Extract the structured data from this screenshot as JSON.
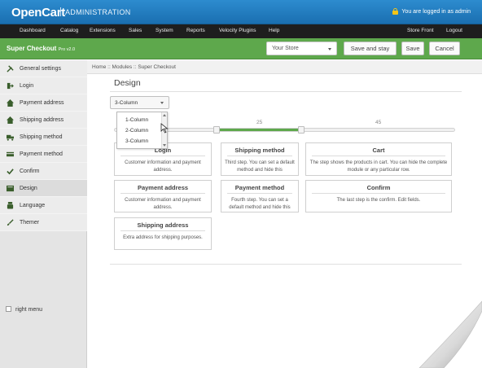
{
  "header": {
    "logo": "OpenCart",
    "subtitle": "ADMINISTRATION",
    "logged_in": "You are logged in as admin"
  },
  "menu": {
    "left": [
      "Dashboard",
      "Catalog",
      "Extensions",
      "Sales",
      "System",
      "Reports",
      "Velocity Plugins",
      "Help"
    ],
    "right": [
      "Store Front",
      "Logout"
    ]
  },
  "module": {
    "title": "Super Checkout",
    "version": "Pro v2.0",
    "store_select": "Your Store",
    "save_stay": "Save and stay",
    "save": "Save",
    "cancel": "Cancel"
  },
  "sidebar": {
    "items": [
      {
        "label": "General settings",
        "icon": "tools-icon"
      },
      {
        "label": "Login",
        "icon": "login-icon"
      },
      {
        "label": "Payment address",
        "icon": "home-icon"
      },
      {
        "label": "Shipping address",
        "icon": "home-icon"
      },
      {
        "label": "Shipping method",
        "icon": "truck-icon"
      },
      {
        "label": "Payment method",
        "icon": "card-icon"
      },
      {
        "label": "Confirm",
        "icon": "check-icon"
      },
      {
        "label": "Design",
        "icon": "design-icon"
      },
      {
        "label": "Language",
        "icon": "language-icon"
      },
      {
        "label": "Themer",
        "icon": "brush-icon"
      }
    ],
    "active_index": 7,
    "right_menu": "right menu"
  },
  "breadcrumb": "Home :: Modules :: Super Checkout",
  "content": {
    "title": "Design",
    "layout_select": "3-Column",
    "layout_options": [
      "1-Column",
      "2-Column",
      "3-Column"
    ],
    "slider": {
      "tick_labels": [
        "25",
        "45"
      ],
      "range_start": 25,
      "range_end": 45,
      "accent": "#5ea84c"
    },
    "cards": [
      {
        "title": "Login",
        "desc": "Customer information and payment address."
      },
      {
        "title": "Shipping method",
        "desc": "Third step. You can set a default method and hide this"
      },
      {
        "title": "Cart",
        "desc": "The step shows the products in cart. You can hide the complete module or any particular row."
      },
      {
        "title": "Payment address",
        "desc": "Customer information and payment address."
      },
      {
        "title": "Payment method",
        "desc": "Fourth step. You can set a default method and hide this"
      },
      {
        "title": "Confirm",
        "desc": "The last step is the confirm. Edit fields."
      },
      {
        "title": "Shipping address",
        "desc": "Extra address for shipping purposes."
      }
    ]
  },
  "colors": {
    "header_blue": "#1f7bc0",
    "menu_dark": "#1e1e1e",
    "module_green": "#5ea84c"
  }
}
